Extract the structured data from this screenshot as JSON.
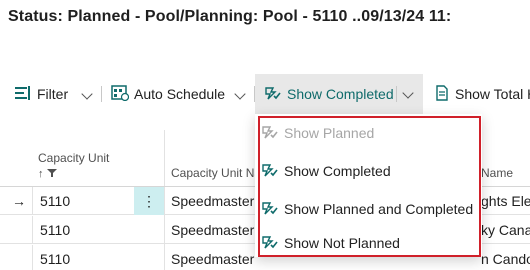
{
  "page": {
    "title": "Status: Planned - Pool/Planning: Pool - 5110  ..09/13/24 11:"
  },
  "toolbar": {
    "filter_label": "Filter",
    "auto_schedule_label": "Auto Schedule",
    "show_completed_label": "Show Completed",
    "show_total_label": "Show Total H"
  },
  "menu": {
    "items": [
      {
        "label": "Show Planned",
        "enabled": false
      },
      {
        "label": "Show Completed",
        "enabled": true
      },
      {
        "label": "Show Planned and Completed",
        "enabled": true
      },
      {
        "label": "Show Not Planned",
        "enabled": true
      }
    ]
  },
  "table": {
    "headers": {
      "capacity_unit": "Capacity Unit",
      "capacity_unit_name": "Capacity Unit Na",
      "name": "Name"
    },
    "rows": [
      {
        "capacity_unit": "5110",
        "capacity_unit_name": "Speedmaster",
        "name": "ghts Elec"
      },
      {
        "capacity_unit": "5110",
        "capacity_unit_name": "Speedmaster",
        "name": "ky Cana"
      },
      {
        "capacity_unit": "5110",
        "capacity_unit_name": "Speedmaster",
        "name": "n Cando"
      }
    ],
    "more_label": "⋮",
    "current_indicator": "→"
  },
  "colors": {
    "accent": "#0f6b6b",
    "highlight_border": "#d0202a",
    "selected_cell": "#cdeef0"
  }
}
